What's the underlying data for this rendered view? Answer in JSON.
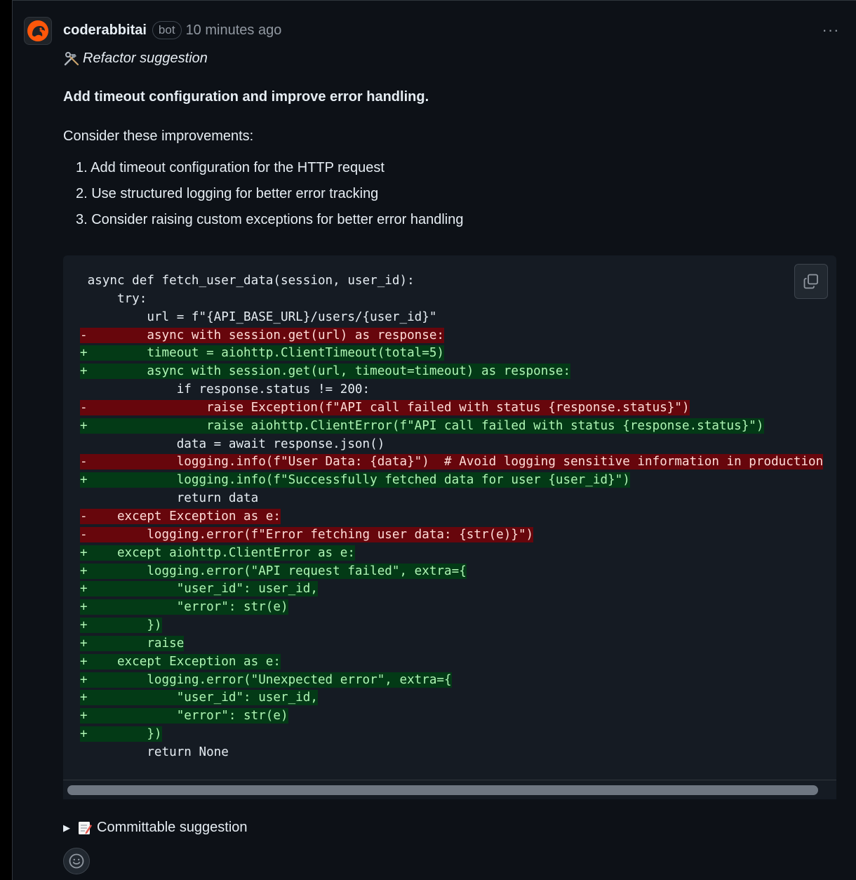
{
  "comment": {
    "author": "coderabbitai",
    "badge": "bot",
    "timestamp": "10 minutes ago",
    "avatar_icon": "rabbit-logo",
    "more_icon": "kebab-horizontal-icon",
    "more_label": "···"
  },
  "body": {
    "refactor_icon": "hammer-wrench-icon",
    "refactor_label": "Refactor suggestion",
    "headline": "Add timeout configuration and improve error handling.",
    "intro": "Consider these improvements:",
    "improvements": [
      "1. Add timeout configuration for the HTTP request",
      "2. Use structured logging for better error tracking",
      "3. Consider raising custom exceptions for better error handling"
    ]
  },
  "code": {
    "copy_icon": "copy-icon",
    "lines": [
      {
        "type": "ctx",
        "text": " async def fetch_user_data(session, user_id):"
      },
      {
        "type": "ctx",
        "text": "     try:"
      },
      {
        "type": "ctx",
        "text": "         url = f\"{API_BASE_URL}/users/{user_id}\""
      },
      {
        "type": "del",
        "text": "-        async with session.get(url) as response:"
      },
      {
        "type": "add",
        "text": "+        timeout = aiohttp.ClientTimeout(total=5)"
      },
      {
        "type": "add",
        "text": "+        async with session.get(url, timeout=timeout) as response:"
      },
      {
        "type": "ctx",
        "text": "             if response.status != 200:"
      },
      {
        "type": "del",
        "text": "-                raise Exception(f\"API call failed with status {response.status}\")"
      },
      {
        "type": "add",
        "text": "+                raise aiohttp.ClientError(f\"API call failed with status {response.status}\")"
      },
      {
        "type": "ctx",
        "text": "             data = await response.json()"
      },
      {
        "type": "del",
        "text": "-            logging.info(f\"User Data: {data}\")  # Avoid logging sensitive information in production"
      },
      {
        "type": "add",
        "text": "+            logging.info(f\"Successfully fetched data for user {user_id}\")"
      },
      {
        "type": "ctx",
        "text": "             return data"
      },
      {
        "type": "del",
        "text": "-    except Exception as e:"
      },
      {
        "type": "del",
        "text": "-        logging.error(f\"Error fetching user data: {str(e)}\")"
      },
      {
        "type": "add",
        "text": "+    except aiohttp.ClientError as e:"
      },
      {
        "type": "add",
        "text": "+        logging.error(\"API request failed\", extra={"
      },
      {
        "type": "add",
        "text": "+            \"user_id\": user_id,"
      },
      {
        "type": "add",
        "text": "+            \"error\": str(e)"
      },
      {
        "type": "add",
        "text": "+        })"
      },
      {
        "type": "add",
        "text": "+        raise"
      },
      {
        "type": "add",
        "text": "+    except Exception as e:"
      },
      {
        "type": "add",
        "text": "+        logging.error(\"Unexpected error\", extra={"
      },
      {
        "type": "add",
        "text": "+            \"user_id\": user_id,"
      },
      {
        "type": "add",
        "text": "+            \"error\": str(e)"
      },
      {
        "type": "add",
        "text": "+        })"
      },
      {
        "type": "ctx",
        "text": "         return None"
      }
    ]
  },
  "footer": {
    "committable_icon": "memo-icon",
    "committable_label": "Committable suggestion",
    "reaction_icon": "smiley-icon"
  },
  "colors": {
    "del_bg": "#67060c",
    "add_bg": "#033a16",
    "code_bg": "#151b23",
    "page_bg": "#0d1117"
  }
}
